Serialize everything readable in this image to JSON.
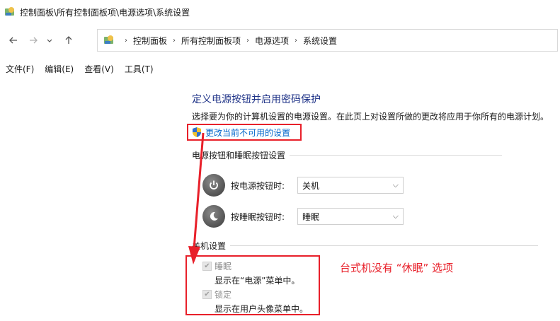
{
  "window": {
    "title": "控制面板\\所有控制面板项\\电源选项\\系统设置"
  },
  "nav": {
    "back_icon": "arrow-left-icon",
    "forward_icon": "arrow-right-icon",
    "recent_icon": "chevron-down-icon",
    "up_icon": "arrow-up-icon"
  },
  "address": {
    "crumbs": [
      "控制面板",
      "所有控制面板项",
      "电源选项",
      "系统设置"
    ]
  },
  "menu": {
    "items": [
      "文件(F)",
      "编辑(E)",
      "查看(V)",
      "工具(T)"
    ]
  },
  "page": {
    "title": "定义电源按钮并启用密码保护",
    "description": "选择要为你的计算机设置的电源设置。在此页上对设置所做的更改将应用于你所有的电源计划。",
    "change_link": "更改当前不可用的设置"
  },
  "buttons_section": {
    "header": "电源按钮和睡眠按钮设置",
    "power": {
      "label": "按电源按钮时:",
      "value": "关机"
    },
    "sleep": {
      "label": "按睡眠按钮时:",
      "value": "睡眠"
    }
  },
  "shutdown_section": {
    "header": "关机设置",
    "options": [
      {
        "name": "睡眠",
        "desc": "显示在“电源”菜单中。",
        "checked": true
      },
      {
        "name": "锁定",
        "desc": "显示在用户头像菜单中。",
        "checked": true
      }
    ]
  },
  "annotation": {
    "note": "台式机没有 “休眠” 选项",
    "color": "#e8202a"
  },
  "colors": {
    "title": "#1e3287",
    "link": "#0066cc",
    "highlight": "#e8202a"
  }
}
